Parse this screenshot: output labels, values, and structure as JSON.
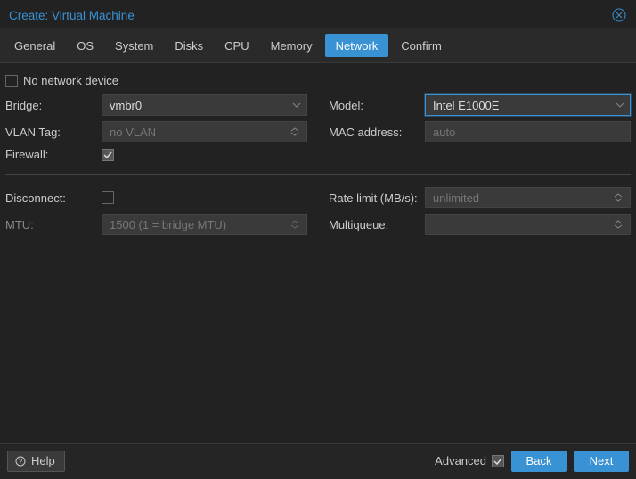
{
  "title": "Create: Virtual Machine",
  "tabs": {
    "general": "General",
    "os": "OS",
    "system": "System",
    "disks": "Disks",
    "cpu": "CPU",
    "memory": "Memory",
    "network": "Network",
    "confirm": "Confirm",
    "active": "network"
  },
  "no_network_device": {
    "label": "No network device",
    "checked": false
  },
  "left": {
    "bridge": {
      "label": "Bridge:",
      "value": "vmbr0"
    },
    "vlan": {
      "label": "VLAN Tag:",
      "placeholder": "no VLAN"
    },
    "firewall": {
      "label": "Firewall:",
      "checked": true
    },
    "disconnect": {
      "label": "Disconnect:",
      "checked": false
    },
    "mtu": {
      "label": "MTU:",
      "placeholder": "1500 (1 = bridge MTU)"
    }
  },
  "right": {
    "model": {
      "label": "Model:",
      "value": "Intel E1000E"
    },
    "mac": {
      "label": "MAC address:",
      "placeholder": "auto"
    },
    "rate": {
      "label": "Rate limit (MB/s):",
      "placeholder": "unlimited"
    },
    "multiqueue": {
      "label": "Multiqueue:",
      "value": ""
    }
  },
  "footer": {
    "help": "Help",
    "advanced": {
      "label": "Advanced",
      "checked": true
    },
    "back": "Back",
    "next": "Next"
  }
}
